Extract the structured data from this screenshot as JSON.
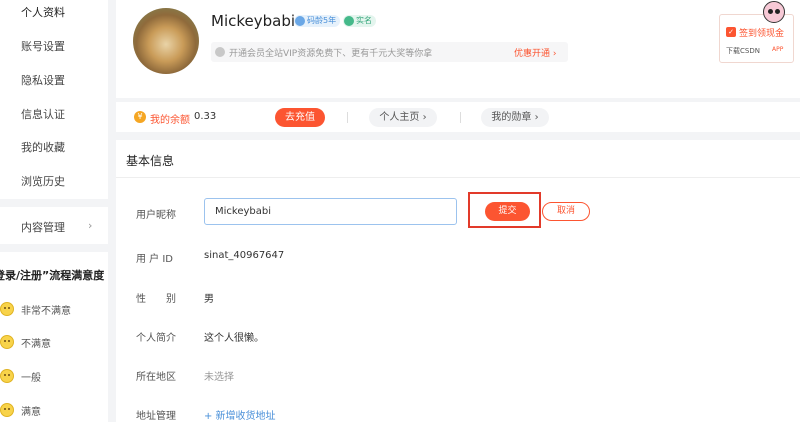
{
  "sidebar": {
    "items": [
      {
        "label": "个人资料",
        "active": true
      },
      {
        "label": "账号设置"
      },
      {
        "label": "隐私设置"
      },
      {
        "label": "信息认证"
      },
      {
        "label": "我的收藏"
      },
      {
        "label": "浏览历史"
      },
      {
        "label": "内容管理",
        "arrow": "›"
      }
    ],
    "survey": {
      "title": "登录/注册”流程满意度",
      "options": [
        {
          "label": "非常不满意",
          "icon": "very-unhappy-face-icon"
        },
        {
          "label": "不满意",
          "icon": "unhappy-face-icon"
        },
        {
          "label": "一般",
          "icon": "neutral-face-icon"
        },
        {
          "label": "满意",
          "icon": "happy-face-icon"
        }
      ]
    }
  },
  "profile": {
    "username": "Mickeybabi",
    "badge_age": "码龄5年",
    "badge_verified": "实名",
    "vip_text": "开通会员全站VIP资源免费下、更有千元大奖等你拿",
    "vip_link": "优惠开通 ›"
  },
  "balance": {
    "coin_symbol": "¥",
    "label": "我的余额",
    "value": "0.33",
    "recharge": "去充值",
    "homepage": "个人主页 ›",
    "medals": "我的勋章 ›"
  },
  "basic_info": {
    "title": "基本信息",
    "nickname_label": "用户昵称",
    "nickname_value": "Mickeybabi",
    "submit": "提交",
    "cancel": "取消",
    "userid_label": "用 户 ID",
    "userid_value": "sinat_40967647",
    "gender_label": "性　　别",
    "gender_value": "男",
    "bio_label": "个人简介",
    "bio_value": "这个人很懒。",
    "region_label": "所在地区",
    "region_value": "未选择",
    "address_label": "地址管理",
    "address_value": "+ 新增收货地址"
  },
  "widget": {
    "title": "签到领现金",
    "subtitle": "下载CSDN",
    "app": "APP"
  },
  "colors": {
    "accent": "#fc5531",
    "highlight_frame": "#e23a2a",
    "link": "#4a90d9"
  }
}
